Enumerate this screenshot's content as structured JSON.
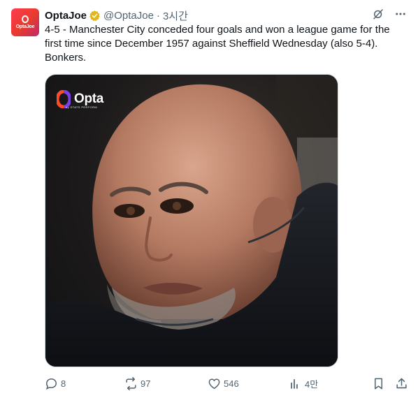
{
  "author": {
    "name": "OptaJoe",
    "handle": "@OptaJoe",
    "time": "3시간",
    "separator": "·",
    "avatar_label": "OptaJoe"
  },
  "tweet": {
    "text_line1": "4-5 - Manchester City conceded four goals and won a league game for the",
    "text_line2": "first time since December 1957 against Sheffield Wednesday (also 5-4).",
    "text_line3": "Bonkers."
  },
  "media": {
    "logo_word": "Opta",
    "logo_sub": "by STATS PERFORM"
  },
  "actions": {
    "replies": "8",
    "reposts": "97",
    "likes": "546",
    "views": "4만"
  },
  "colors": {
    "text": "#0f1419",
    "secondary": "#536471",
    "verified_gold": "#e2b719",
    "opta_orange": "#ff4a2b",
    "opta_purple": "#7b3fe4"
  }
}
